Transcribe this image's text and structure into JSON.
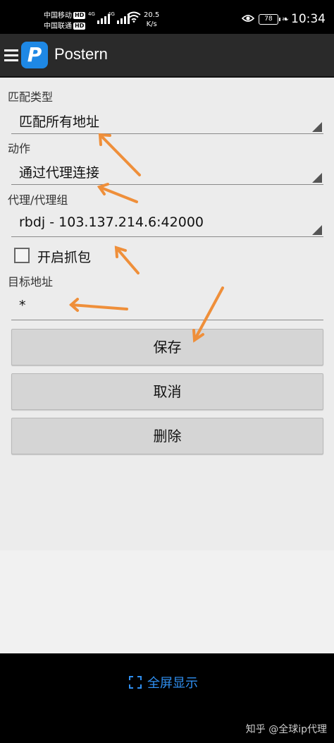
{
  "status_bar": {
    "carrier1": "中国移动",
    "carrier2": "中国联通",
    "hd": "HD",
    "net_tag": "4G",
    "speed_value": "20.5",
    "speed_unit": "K/s",
    "battery": "78",
    "time": "10:34"
  },
  "app": {
    "title": "Postern",
    "logo_letter": "P"
  },
  "form": {
    "match_type_label": "匹配类型",
    "match_type_value": "匹配所有地址",
    "action_label": "动作",
    "action_value": "通过代理连接",
    "proxy_label": "代理/代理组",
    "proxy_value": "rbdj - 103.137.214.6:42000",
    "capture_label": "开启抓包",
    "capture_checked": false,
    "target_label": "目标地址",
    "target_value": "*"
  },
  "buttons": {
    "save": "保存",
    "cancel": "取消",
    "delete": "删除"
  },
  "bottom": {
    "fullscreen_label": "全屏显示",
    "watermark": "知乎 @全球ip代理"
  },
  "colors": {
    "annotation_arrow": "#ef8f3a",
    "accent_blue": "#2f8ff0",
    "logo_blue": "#1e88e5"
  }
}
